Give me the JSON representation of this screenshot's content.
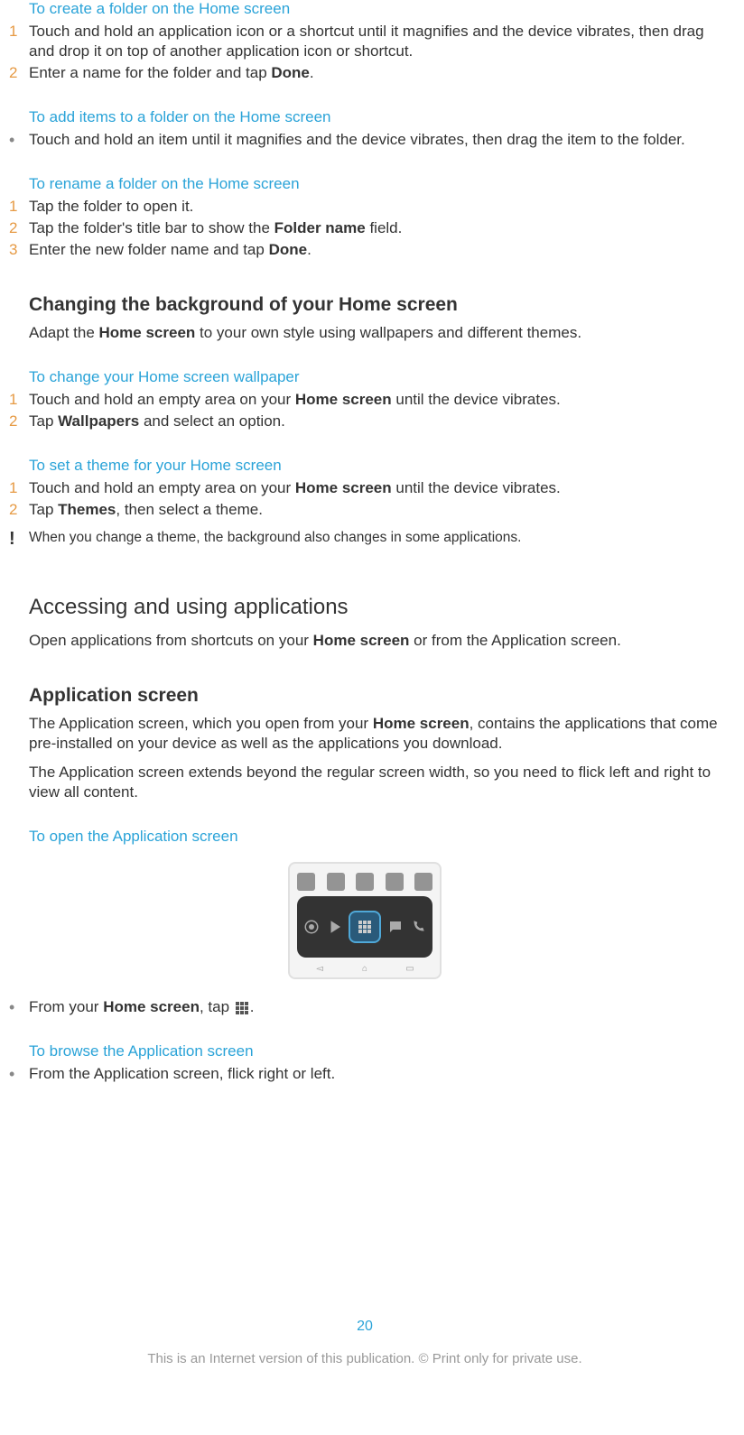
{
  "s1": {
    "heading": "To create a folder on the Home screen",
    "steps": [
      {
        "n": "1",
        "t": "Touch and hold an application icon or a shortcut until it magnifies and the device vibrates, then drag and drop it on top of another application icon or shortcut."
      },
      {
        "n": "2",
        "t": "Enter a name for the folder and tap ",
        "b": "Done",
        "after": "."
      }
    ]
  },
  "s2": {
    "heading": "To add items to a folder on the Home screen",
    "bullet": "Touch and hold an item until it magnifies and the device vibrates, then drag the item to the folder."
  },
  "s3": {
    "heading": "To rename a folder on the Home screen",
    "steps": [
      {
        "n": "1",
        "t": "Tap the folder to open it."
      },
      {
        "n": "2",
        "t": "Tap the folder's title bar to show the ",
        "b": "Folder name",
        "after": " field."
      },
      {
        "n": "3",
        "t": "Enter the new folder name and tap ",
        "b": "Done",
        "after": "."
      }
    ]
  },
  "s4": {
    "heading": "Changing the background of your Home screen",
    "para_pre": "Adapt the ",
    "para_b": "Home screen",
    "para_post": " to your own style using wallpapers and different themes."
  },
  "s5": {
    "heading": "To change your Home screen wallpaper",
    "steps": [
      {
        "n": "1",
        "t": "Touch and hold an empty area on your ",
        "b": "Home screen",
        "after": " until the device vibrates."
      },
      {
        "n": "2",
        "t": "Tap ",
        "b": "Wallpapers",
        "after": " and select an option."
      }
    ]
  },
  "s6": {
    "heading": "To set a theme for your Home screen",
    "steps": [
      {
        "n": "1",
        "t": "Touch and hold an empty area on your ",
        "b": "Home screen",
        "after": " until the device vibrates."
      },
      {
        "n": "2",
        "t": "Tap ",
        "b": "Themes",
        "after": ", then select a theme."
      }
    ],
    "note": "When you change a theme, the background also changes in some applications."
  },
  "s7": {
    "heading": "Accessing and using applications",
    "para_pre": "Open applications from shortcuts on your ",
    "para_b": "Home screen",
    "para_post": " or from the Application screen."
  },
  "s8": {
    "heading": "Application screen",
    "para1_pre": "The Application screen, which you open from your ",
    "para1_b": "Home screen",
    "para1_post": ", contains the applications that come pre-installed on your device as well as the applications you download.",
    "para2": "The Application screen extends beyond the regular screen width, so you need to flick left and right to view all content."
  },
  "s9": {
    "heading": "To open the Application screen",
    "bullet_pre": "From your ",
    "bullet_b": "Home screen",
    "bullet_mid": ", tap ",
    "bullet_post": "."
  },
  "s10": {
    "heading": "To browse the Application screen",
    "bullet": "From the Application screen, flick right or left."
  },
  "page_num": "20",
  "footer": "This is an Internet version of this publication. © Print only for private use."
}
